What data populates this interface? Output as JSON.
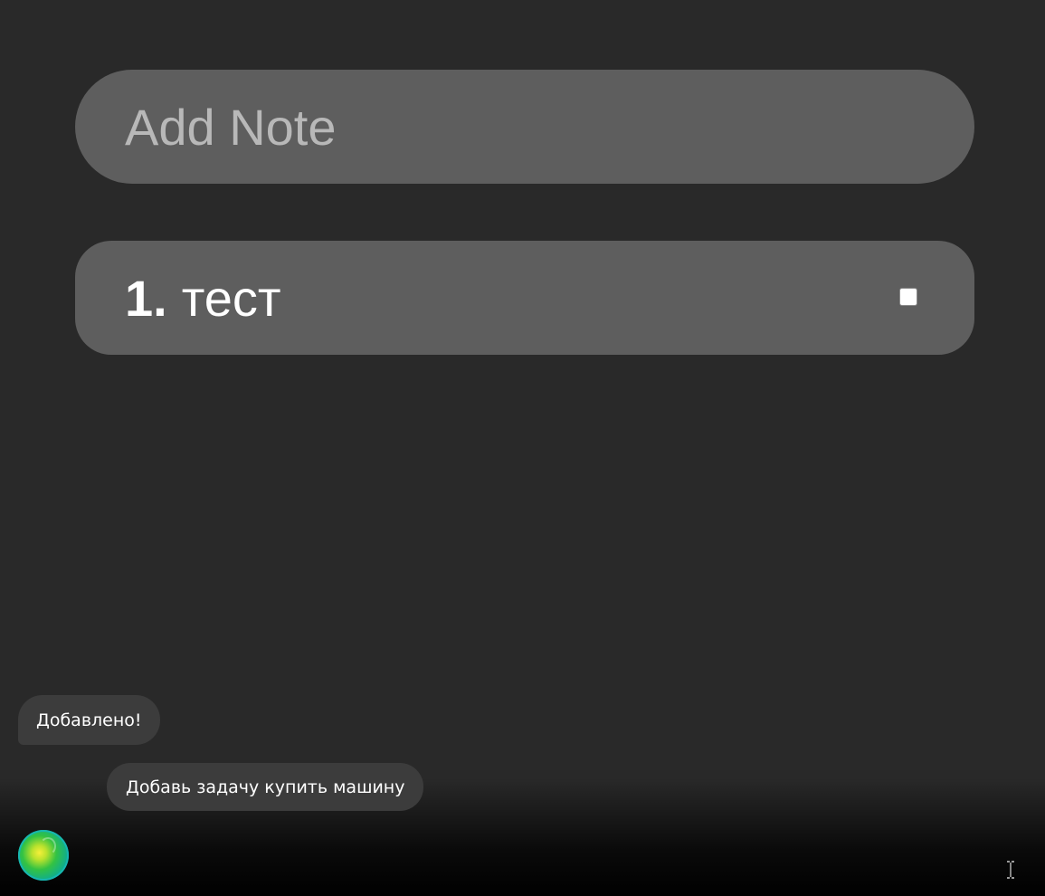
{
  "note_input": {
    "placeholder": "Add Note",
    "value": ""
  },
  "notes": [
    {
      "number": "1.",
      "text": "тест",
      "checked": false
    }
  ],
  "assistant": {
    "messages": [
      {
        "role": "assistant",
        "text": "Добавлено!"
      },
      {
        "role": "user",
        "text": "Добавь задачу купить машину"
      }
    ],
    "orb_icon": "assistant-orb-icon"
  },
  "pointer": {
    "icon": "text-cursor-icon"
  },
  "colors": {
    "background": "#292929",
    "card": "#5e5e5e",
    "bubble": "#3c3c3c",
    "text": "#ffffff",
    "placeholder": "#b8b8b8"
  }
}
